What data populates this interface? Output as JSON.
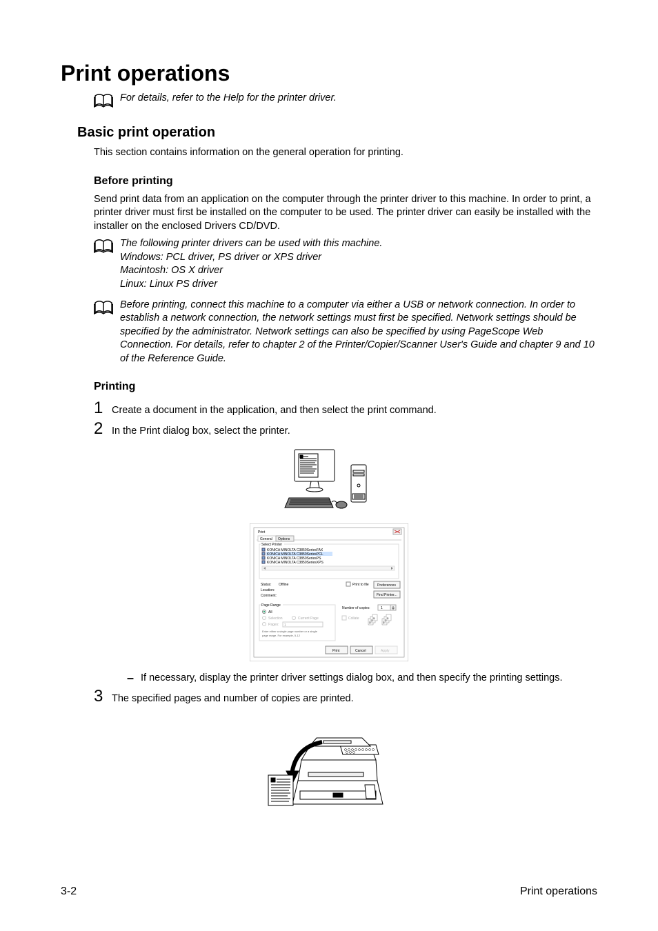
{
  "title": "Print operations",
  "noteTop": "For details, refer to the Help for the printer driver.",
  "section1": {
    "title": "Basic print operation",
    "intro": "This section contains information on the general operation for printing."
  },
  "before": {
    "title": "Before printing",
    "para": "Send print data from an application on the computer through the printer driver to this machine. In order to print, a printer driver must first be installed on the computer to be used. The printer driver can easily be installed with the installer on the enclosed Drivers CD/DVD.",
    "note1": {
      "l1": "The following printer drivers can be used with this machine.",
      "l2": "Windows: PCL driver, PS driver or XPS driver",
      "l3": "Macintosh: OS X driver",
      "l4": "Linux: Linux PS driver"
    },
    "note2": "Before printing, connect this machine to a computer via either a USB or network connection. In order to establish a network connection, the network settings must first be specified. Network settings should be specified by the administrator. Network settings can also be specified by using PageScope Web Connection. For details, refer to chapter 2 of the Printer/Copier/Scanner User's Guide and chapter 9 and 10 of the Reference Guide."
  },
  "printing": {
    "title": "Printing",
    "steps": {
      "s1": "Create a document in the application, and then select the print command.",
      "s2": "In the Print dialog box, select the printer.",
      "s2bullet": "If necessary, display the printer driver settings dialog box, and then specify the printing settings.",
      "s3": "The specified pages and number of copies are printed."
    }
  },
  "dialog": {
    "title": "Print",
    "tabGeneral": "General",
    "tabOptions": "Options",
    "selectPrinter": "Select Printer",
    "printers": {
      "p1": "KONICA MINOLTA C3850SeriesFAX",
      "p2": "KONICA MINOLTA C3850SeriesPCL",
      "p3": "KONICA MINOLTA C3850SeriesPS",
      "p4": "KONICA MINOLTA C3850SeriesXPS"
    },
    "statusLbl": "Status:",
    "statusVal": "Offline",
    "locationLbl": "Location:",
    "commentLbl": "Comment:",
    "printToFile": "Print to file",
    "preferences": "Preferences",
    "findPrinter": "Find Printer...",
    "pageRange": "Page Range",
    "all": "All",
    "selection": "Selection",
    "currentPage": "Current Page",
    "pages": "Pages:",
    "pagesVal": "1",
    "hint": "Enter either a single page number or a single page range. For example, 5-12",
    "copiesLbl": "Number of copies:",
    "copiesVal": "1",
    "collate": "Collate",
    "btnPrint": "Print",
    "btnCancel": "Cancel",
    "btnApply": "Apply"
  },
  "footer": {
    "left": "3-2",
    "right": "Print operations"
  }
}
